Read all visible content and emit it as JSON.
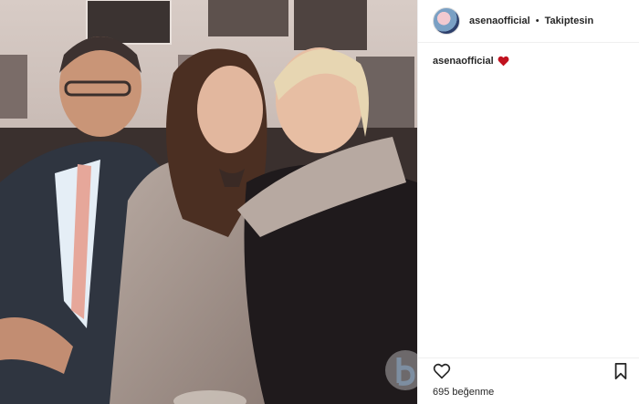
{
  "post": {
    "username": "asenaofficial",
    "separator": "•",
    "follow_state": "Takiptesin",
    "caption_username": "asenaofficial",
    "likes_text": "695 beğenme"
  },
  "icons": {
    "like": "heart-outline-icon",
    "save": "bookmark-icon",
    "caption_emoji": "red-heart-icon"
  },
  "colors": {
    "accent_heart": "#c1121f",
    "text": "#262626"
  }
}
